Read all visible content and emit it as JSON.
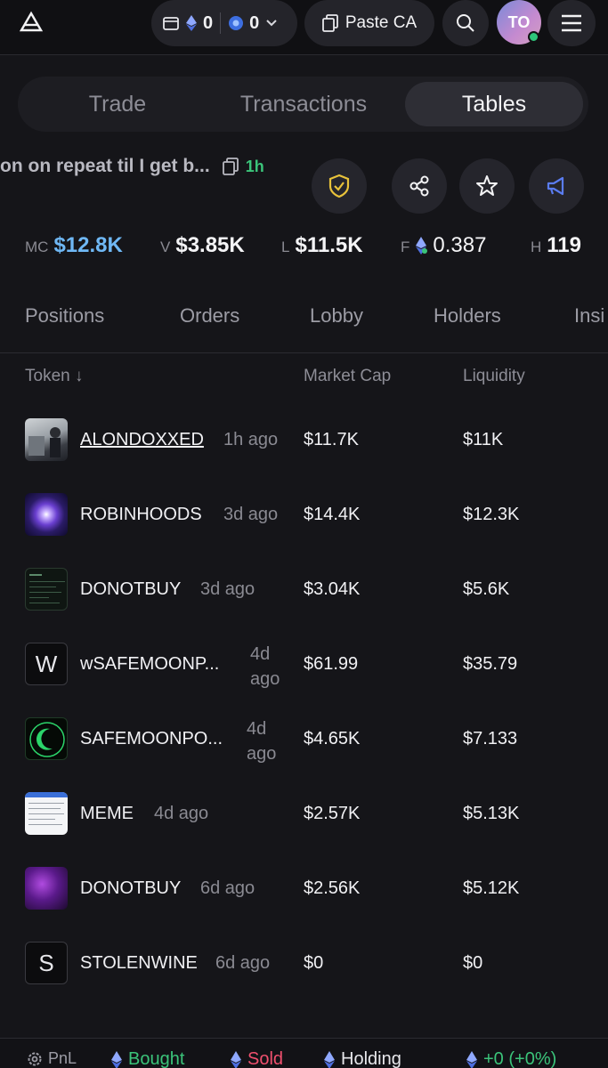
{
  "header": {
    "wallet_sol": "0",
    "wallet_eth": "0",
    "paste_label": "Paste CA",
    "avatar_initials": "TO"
  },
  "tabs": [
    {
      "label": "Trade",
      "active": false
    },
    {
      "label": "Transactions",
      "active": false
    },
    {
      "label": "Tables",
      "active": true
    }
  ],
  "token": {
    "title": "on on repeat til I get b...",
    "age": "1h"
  },
  "stats": {
    "mc_label": "MC",
    "mc_value": "$12.8K",
    "v_label": "V",
    "v_value": "$3.85K",
    "l_label": "L",
    "l_value": "$11.5K",
    "f_label": "F",
    "f_value": "0.387",
    "h_label": "H",
    "h_value": "119"
  },
  "subtabs": [
    "Positions",
    "Orders",
    "Lobby",
    "Holders",
    "Insi"
  ],
  "table": {
    "col_token": "Token ↓",
    "col_mc": "Market Cap",
    "col_liq": "Liquidity",
    "rows": [
      {
        "name": "ALONDOXXED",
        "age": "1h ago",
        "mc": "$11.7K",
        "liq": "$11K"
      },
      {
        "name": "ROBINHOODS",
        "age": "3d ago",
        "mc": "$14.4K",
        "liq": "$12.3K"
      },
      {
        "name": "DONOTBUY",
        "age": "3d ago",
        "mc": "$3.04K",
        "liq": "$5.6K"
      },
      {
        "name": "wSAFEMOONP...",
        "age": "4d ago",
        "mc": "$61.99",
        "liq": "$35.79",
        "letter": "W"
      },
      {
        "name": "SAFEMOONPO...",
        "age": "4d ago",
        "mc": "$4.65K",
        "liq": "$7.133"
      },
      {
        "name": "MEME",
        "age": "4d ago",
        "mc": "$2.57K",
        "liq": "$5.13K"
      },
      {
        "name": "DONOTBUY",
        "age": "6d ago",
        "mc": "$2.56K",
        "liq": "$5.12K"
      },
      {
        "name": "STOLENWINE",
        "age": "6d ago",
        "mc": "$0",
        "liq": "$0",
        "letter": "S"
      }
    ]
  },
  "footer": {
    "pnl": "PnL",
    "bought": "Bought",
    "sold": "Sold",
    "holding": "Holding",
    "pnl_value": "+0 (+0%)"
  },
  "colors": {
    "accent_blue": "#6fb8f5",
    "green": "#3bc47a",
    "red": "#f0506e",
    "shield_yellow": "#e8c23a",
    "megaphone_blue": "#5a7cf0"
  }
}
